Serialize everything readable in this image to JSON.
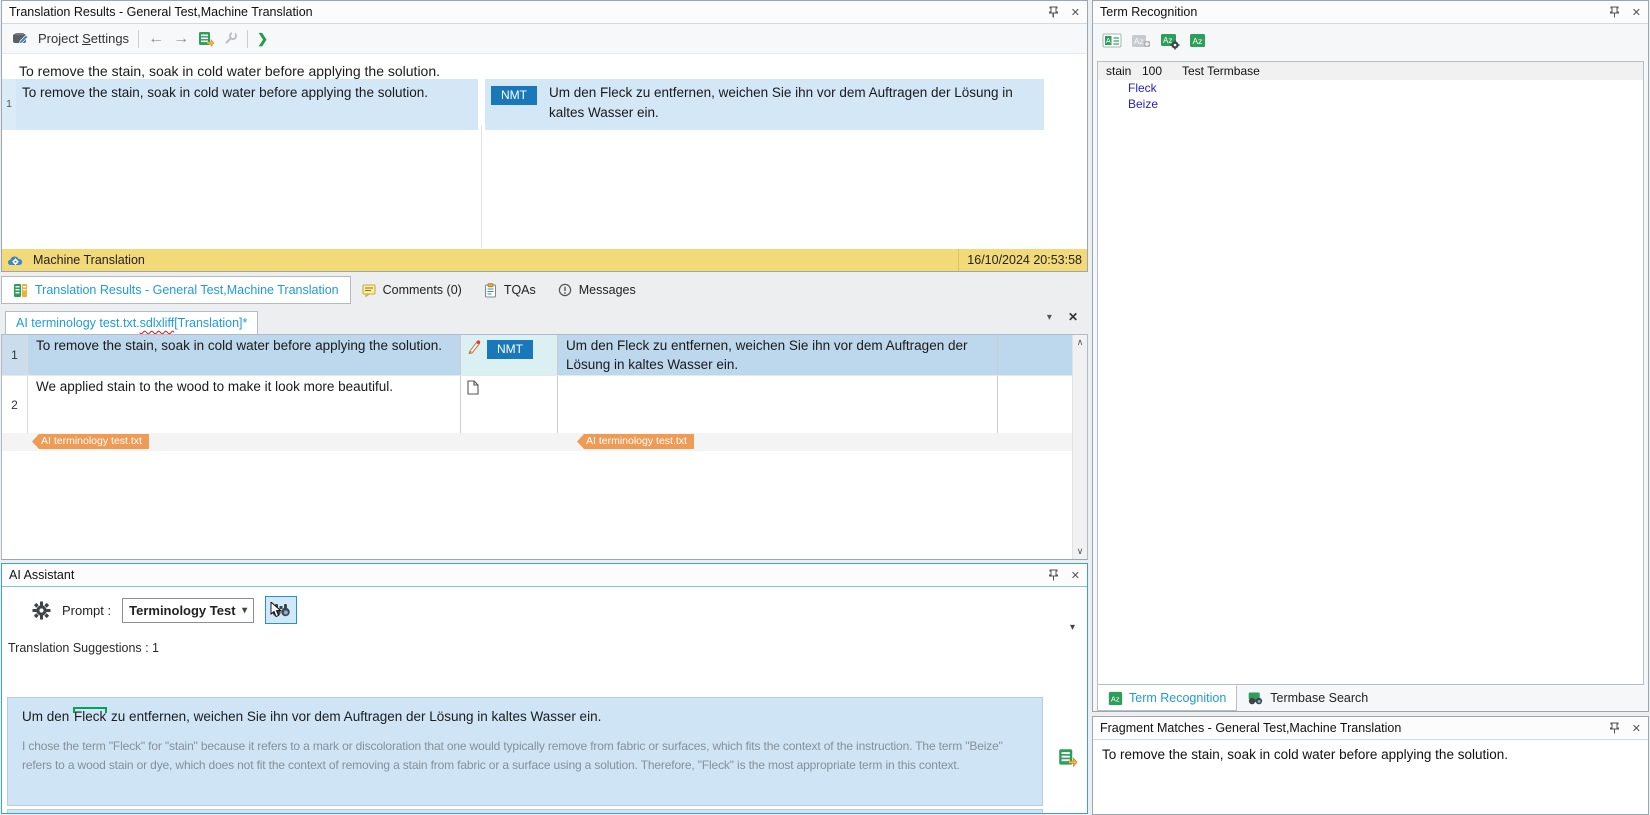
{
  "icons": {
    "close": "✕",
    "dropdown": "▾",
    "scroll_up": "∧",
    "scroll_down": "∨",
    "back": "←",
    "forward": "→",
    "chevron_right": "❯"
  },
  "translation_results": {
    "title": "Translation Results - General Test,Machine Translation",
    "toolbar": {
      "project_settings_pre": "Project ",
      "project_settings_mnemonic": "S",
      "project_settings_post": "ettings"
    },
    "source_preview": "To remove the stain, soak in cold water before applying the solution.",
    "row": {
      "number": "1",
      "source": "To remove the stain, soak in cold water before applying the solution.",
      "origin_badge": "NMT",
      "target": "Um den Fleck zu entfernen, weichen Sie ihn vor dem Auftragen der Lösung in kaltes Wasser ein."
    },
    "mt_bar": {
      "label": "Machine Translation",
      "timestamp": "16/10/2024 20:53:58"
    }
  },
  "bottom_tabs": {
    "translation_results": "Translation Results - General Test,Machine Translation",
    "comments": "Comments (0)",
    "tqas": "TQAs",
    "messages": "Messages"
  },
  "editor": {
    "file_tab": {
      "name_prefix": "AI terminology test.txt.",
      "name_flagged": "sdlxliff",
      "name_suffix": " [Translation]*"
    },
    "rows": [
      {
        "number": "1",
        "source": "To remove the stain, soak in cold water before applying the solution.",
        "status": "NMT",
        "target": "Um den Fleck zu entfernen, weichen Sie ihn vor dem Auftragen der Lösung in kaltes Wasser ein."
      },
      {
        "number": "2",
        "source": "We applied stain to the wood to make it look more beautiful.",
        "status": "",
        "target": ""
      }
    ],
    "source_tag": "AI terminology test.txt",
    "target_tag": "AI terminology test.txt"
  },
  "ai_assistant": {
    "title": "AI Assistant",
    "prompt_label": "Prompt :",
    "prompt_value": "Terminology Test",
    "suggestions_label": "Translation Suggestions : 1",
    "suggestion": {
      "prefix": "Um den ",
      "term": "Fleck",
      "suffix": " zu entfernen, weichen Sie ihn vor dem Auftragen der Lösung in kaltes Wasser ein.",
      "explanation": "I chose the term \"Fleck\" for \"stain\" because it refers to a mark or discoloration that one would typically remove from fabric or surfaces, which fits the context of the instruction. The term \"Beize\" refers to a wood stain or dye, which does not fit the context of removing a stain from fabric or a surface using a solution. Therefore, \"Fleck\" is the most appropriate term in this context."
    }
  },
  "term_recognition": {
    "title": "Term Recognition",
    "entry": {
      "term": "stain",
      "score": "100",
      "termbase": "Test Termbase",
      "translations": [
        "Fleck",
        "Beize"
      ]
    },
    "tabs": {
      "term_recognition": "Term Recognition",
      "termbase_search": "Termbase Search"
    }
  },
  "fragment_matches": {
    "title": "Fragment Matches - General Test,Machine Translation",
    "text": "To remove the stain, soak in cold water before applying the solution."
  },
  "colors": {
    "accent_blue": "#1e9cd7",
    "selection_blue": "#bdd7ec",
    "row_blue": "#d3e7f7",
    "status_cyan": "#dbf0f2",
    "nmt_badge": "#1878ba",
    "mt_bar_yellow": "#f3da78",
    "tag_orange": "#ee9b55",
    "link_blue": "#2323cc",
    "term_green": "#21a366",
    "focus_border": "#3f9fdc"
  }
}
